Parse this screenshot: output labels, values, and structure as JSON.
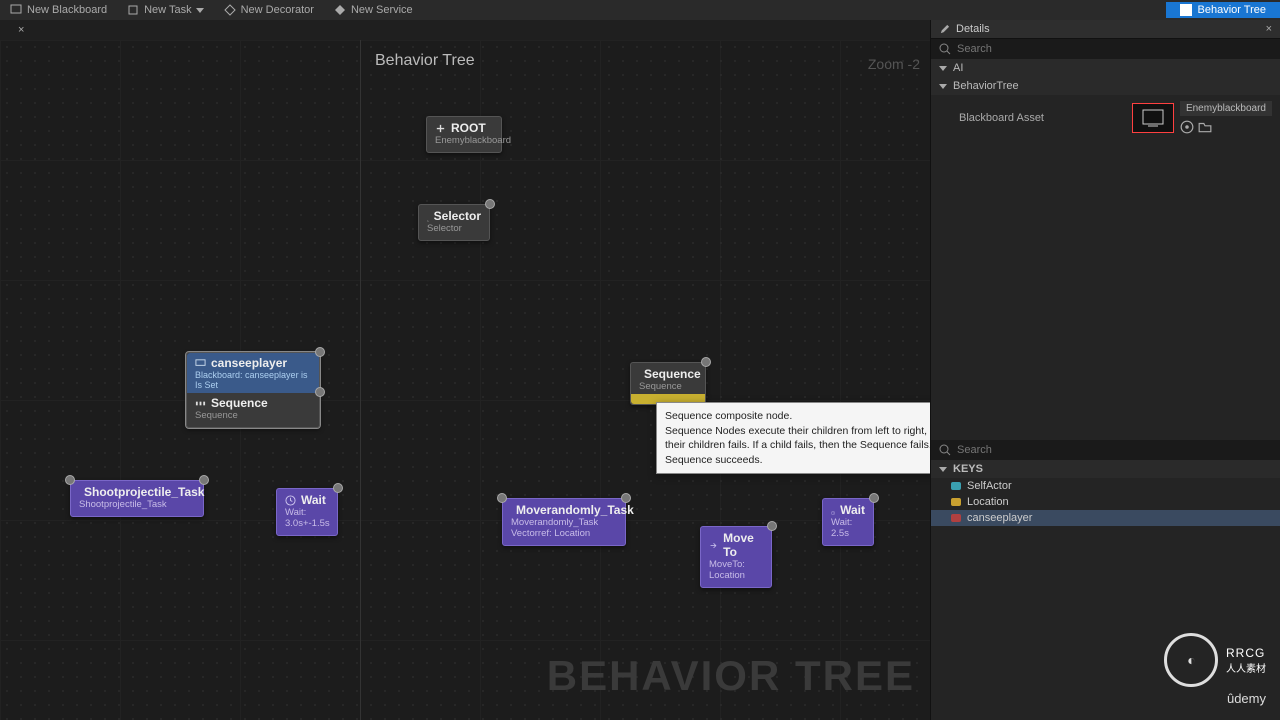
{
  "toolbar": {
    "new_blackboard": "New Blackboard",
    "new_task": "New Task",
    "new_decorator": "New Decorator",
    "new_service": "New Service",
    "behavior_tree": "Behavior Tree"
  },
  "graph": {
    "title": "Behavior Tree",
    "zoom": "Zoom  -2",
    "watermark": "BEHAVIOR TREE"
  },
  "nodes": {
    "root": {
      "title": "ROOT",
      "sub": "Enemyblackboard"
    },
    "selector": {
      "title": "Selector",
      "sub": "Selector"
    },
    "canseeplayer": {
      "dec_title": "canseeplayer",
      "dec_sub": "Blackboard: canseeplayer is Is Set",
      "seq_title": "Sequence",
      "seq_sub": "Sequence"
    },
    "sequence2": {
      "title": "Sequence",
      "sub": "Sequence"
    },
    "shoot": {
      "title": "Shootprojectile_Task",
      "sub": "Shootprojectile_Task"
    },
    "wait1": {
      "title": "Wait",
      "sub": "Wait: 3.0s+-1.5s"
    },
    "moverandom": {
      "title": "Moverandomly_Task",
      "sub1": "Moverandomly_Task",
      "sub2": "Vectorref: Location"
    },
    "moveto": {
      "title": "Move To",
      "sub": "MoveTo: Location"
    },
    "wait2": {
      "title": "Wait",
      "sub": "Wait: 2.5s"
    }
  },
  "tooltip": {
    "title": "Sequence composite node.",
    "body": "Sequence Nodes execute their children from left to right, and will stop executing its children when one of their children fails. If a child fails, then the Sequence fails. If all the Sequence's children succeed, then the Sequence succeeds."
  },
  "details": {
    "panel_title": "Details",
    "search_placeholder": "Search",
    "section_ai": "AI",
    "section_bt": "BehaviorTree",
    "blackboard_asset_label": "Blackboard Asset",
    "blackboard_asset_value": "Enemyblackboard"
  },
  "keys": {
    "header": "KEYS",
    "search_placeholder": "Search",
    "items": [
      {
        "color": "cyan",
        "label": "SelfActor"
      },
      {
        "color": "yel",
        "label": "Location"
      },
      {
        "color": "red",
        "label": "canseeplayer"
      }
    ],
    "selected_index": 2
  },
  "branding": {
    "logo_text": "RRCG",
    "logo_sub": "人人素材",
    "udemy": "ûdemy"
  }
}
